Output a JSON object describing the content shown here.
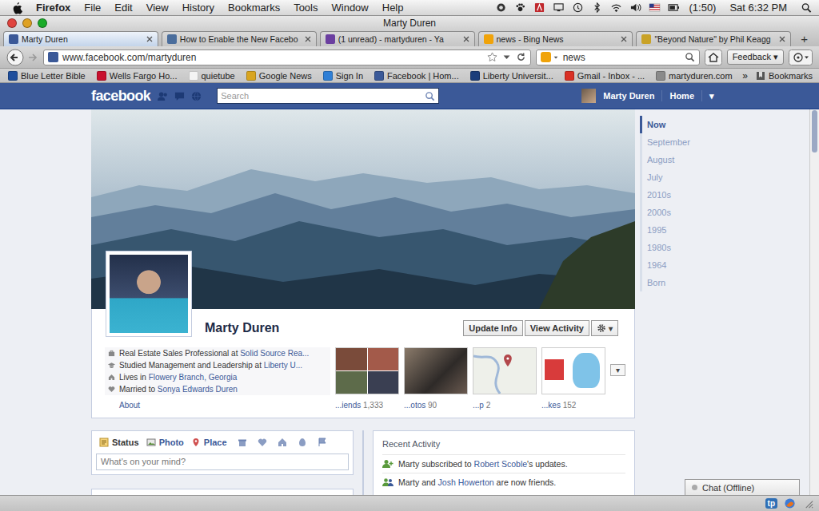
{
  "menubar": {
    "app": "Firefox",
    "menus": [
      "File",
      "Edit",
      "View",
      "History",
      "Bookmarks",
      "Tools",
      "Window",
      "Help"
    ],
    "battery": "(1:50)",
    "clock": "Sat 6:32 PM"
  },
  "window": {
    "title": "Marty Duren"
  },
  "tabs": [
    {
      "label": "Marty Duren",
      "selected": true,
      "color": "#3b5998"
    },
    {
      "label": "How to Enable the New Facebo",
      "selected": false,
      "color": "#4a6d9c"
    },
    {
      "label": "(1 unread) - martyduren - Ya",
      "selected": false,
      "color": "#6b3fa0"
    },
    {
      "label": "news - Bing News",
      "selected": false,
      "color": "#f0a30a"
    },
    {
      "label": "\"Beyond Nature\" by Phil Keagg",
      "selected": false,
      "color": "#c9a227"
    }
  ],
  "new_tab": "+",
  "navbar": {
    "url": "www.facebook.com/martyduren",
    "search": "news",
    "feedback": "Feedback ▾"
  },
  "bookmarks": {
    "items": [
      {
        "label": "Blue Letter Bible",
        "color": "#1f4e9c"
      },
      {
        "label": "Wells Fargo Ho...",
        "color": "#c8102e"
      },
      {
        "label": "quietube",
        "color": "#f4f4f4"
      },
      {
        "label": "Google News",
        "color": "#d9a520"
      },
      {
        "label": "Sign In",
        "color": "#2f7fd6"
      },
      {
        "label": "Facebook | Hom...",
        "color": "#3b5998"
      },
      {
        "label": "Liberty Universit...",
        "color": "#1b3d7a"
      },
      {
        "label": "Gmail - Inbox - ...",
        "color": "#d93025"
      },
      {
        "label": "martyduren.com",
        "color": "#8a8a8a"
      }
    ],
    "more": "»",
    "menu": "Bookmarks"
  },
  "facebook": {
    "logo": "facebook",
    "search_placeholder": "Search",
    "user": "Marty Duren",
    "home": "Home",
    "menu": "▾"
  },
  "profile": {
    "name": "Marty Duren",
    "buttons": [
      "Update Info",
      "View Activity"
    ],
    "settings": "▾",
    "info": [
      {
        "kind": "work",
        "text": "Real Estate Sales Professional at ",
        "link": "Solid Source Rea..."
      },
      {
        "kind": "education",
        "text": "Studied Management and Leadership at ",
        "link": "Liberty U..."
      },
      {
        "kind": "home",
        "text": "Lives in ",
        "link": "Flowery Branch, Georgia"
      },
      {
        "kind": "relationship",
        "text": "Married to ",
        "link": "Sonya Edwards Duren"
      }
    ],
    "about": "About",
    "tiles": [
      {
        "kind": "friends",
        "label": "...iends",
        "count": "1,333"
      },
      {
        "kind": "photos",
        "label": "...otos",
        "count": "90"
      },
      {
        "kind": "map",
        "label": "...p",
        "count": "2"
      },
      {
        "kind": "likes",
        "label": "...kes",
        "count": "152"
      }
    ],
    "tiles_more": "▾"
  },
  "timeline": [
    {
      "label": "Now",
      "selected": true
    },
    {
      "label": "September",
      "selected": false
    },
    {
      "label": "August",
      "selected": false
    },
    {
      "label": "July",
      "selected": false
    },
    {
      "label": "2010s",
      "selected": false
    },
    {
      "label": "2000s",
      "selected": false
    },
    {
      "label": "1995",
      "selected": false
    },
    {
      "label": "1980s",
      "selected": false
    },
    {
      "label": "1964",
      "selected": false
    },
    {
      "label": "Born",
      "selected": false
    }
  ],
  "composer": {
    "tabs": [
      {
        "kind": "status",
        "label": "Status",
        "selected": true
      },
      {
        "kind": "photo",
        "label": "Photo",
        "selected": false
      },
      {
        "kind": "place",
        "label": "Place",
        "selected": false
      }
    ],
    "placeholder": "What's on your mind?"
  },
  "recent_activity": {
    "title": "Recent Activity",
    "items": [
      {
        "kind": "subscribe",
        "before": "Marty subscribed to ",
        "link": "Robert Scoble",
        "after": "'s updates."
      },
      {
        "kind": "friend",
        "before": "Marty and ",
        "link": "Josh Howerton",
        "after": " are now friends."
      }
    ]
  },
  "chat": {
    "label": "Chat (Offline)"
  },
  "statusbar": {
    "addon": "tp"
  },
  "scrollbar": {
    "level": 0.11
  }
}
